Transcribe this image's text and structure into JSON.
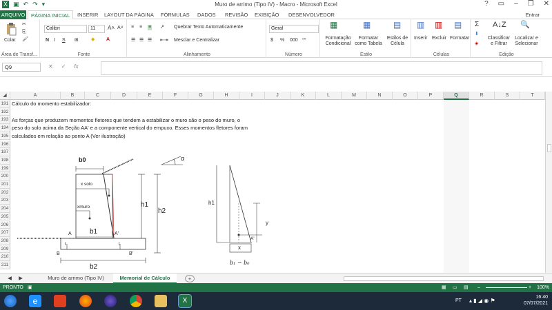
{
  "window": {
    "title": "Muro de arrimo (Tipo IV) - Macro - Microsoft Excel",
    "signin": "Entrar"
  },
  "menu": {
    "file": "ARQUIVO",
    "tabs": [
      "PÁGINA INICIAL",
      "INSERIR",
      "LAYOUT DA PÁGINA",
      "FÓRMULAS",
      "DADOS",
      "REVISÃO",
      "EXIBIÇÃO",
      "DESENVOLVEDOR"
    ]
  },
  "ribbon": {
    "clipboard": {
      "paste": "Colar",
      "label": "Área de Transf..."
    },
    "font": {
      "name": "Calibri",
      "size": "11",
      "bold": "N",
      "italic": "I",
      "underline": "S",
      "label": "Fonte"
    },
    "alignment": {
      "wrap": "Quebrar Texto Automaticamente",
      "merge": "Mesclar e Centralizar",
      "label": "Alinhamento"
    },
    "number": {
      "format": "Geral",
      "label": "Número"
    },
    "styles": {
      "conditional": "Formatação Condicional",
      "table": "Formatar como Tabela",
      "cell": "Estilos de Célula",
      "label": "Estilo"
    },
    "cells": {
      "insert": "Inserir",
      "delete": "Excluir",
      "format": "Formatar",
      "label": "Células"
    },
    "editing": {
      "sort": "Classificar e Filtrar",
      "find": "Localizar e Selecionar",
      "label": "Edição"
    }
  },
  "formula": {
    "namebox": "Q9",
    "fx": "fx",
    "value": ""
  },
  "columns": [
    "A",
    "B",
    "C",
    "D",
    "E",
    "F",
    "G",
    "H",
    "I",
    "J",
    "K",
    "L",
    "M",
    "N",
    "O",
    "P",
    "Q",
    "R",
    "S",
    "T"
  ],
  "selected_column": "Q",
  "rows": [
    "191",
    "192",
    "193",
    "194",
    "195",
    "196",
    "197",
    "198",
    "199",
    "200",
    "201",
    "202",
    "203",
    "204",
    "205",
    "206",
    "207",
    "208",
    "209",
    "210",
    "211"
  ],
  "cells": {
    "r191": "Cálculo do momento estabilizador:",
    "r193": "As forças que produzem momentos fletores que tendem a estabilizar o muro são o peso do muro, o",
    "r194": "peso do solo acima da Seção AA' e a componente vertical do empuxo. Esses momentos fletores foram",
    "r195": "calculados em relação ao ponto A (Ver ilustração)"
  },
  "diagram": {
    "b0": "b0",
    "alpha": "α",
    "xsolo": "x solo",
    "xmuro": "xmuro",
    "h1": "h1",
    "h2": "h2",
    "b1": "b1",
    "b2": "b2",
    "A": "A",
    "Aprime": "A'",
    "B": "B",
    "Bprime": "B'",
    "t1": "t",
    "t2": "t",
    "h1b": "h1",
    "y": "y",
    "x": "x",
    "Aprime2": "A'",
    "formula": "b₁ − b₀"
  },
  "sheets": {
    "tab1": "Muro de arrimo (Tipo IV)",
    "tab2": "Memorial de Cálculo",
    "add": "+"
  },
  "status": {
    "left": "PRONTO",
    "zoom": "100%"
  },
  "tray": {
    "lang": "PT",
    "time": "16:40",
    "date": "07/07/2021"
  }
}
